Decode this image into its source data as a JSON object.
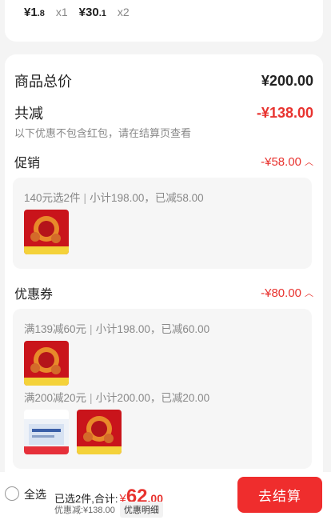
{
  "top_items": [
    {
      "currency": "¥",
      "int": "1",
      "dec": ".8",
      "qty": "x1"
    },
    {
      "currency": "¥",
      "int": "30",
      "dec": ".1",
      "qty": "x2"
    }
  ],
  "summary": {
    "total_label": "商品总价",
    "total_value": "¥200.00",
    "discount_label": "共减",
    "discount_value": "-¥138.00",
    "discount_note": "以下优惠不包含红包，请在结算页查看"
  },
  "promo": {
    "title": "促销",
    "amount": "-¥58.00",
    "line_rule": "140元选2件",
    "line_detail": "小计198.00，已减58.00"
  },
  "coupon": {
    "title": "优惠券",
    "amount": "-¥80.00",
    "rule1": "满139减60元",
    "detail1": "小计198.00，已减60.00",
    "rule2": "满200减20元",
    "detail2": "小计200.00，已减20.00"
  },
  "bottom": {
    "select_all": "全选",
    "selected_text": "已选2件,合计:",
    "currency": "¥",
    "total_int": "62",
    "total_dec": ".00",
    "saved_text": "优惠减:¥138.00",
    "detail_btn": "优惠明细",
    "checkout": "去结算"
  },
  "colors": {
    "accent": "#e8332f",
    "button": "#ef2d2d"
  }
}
